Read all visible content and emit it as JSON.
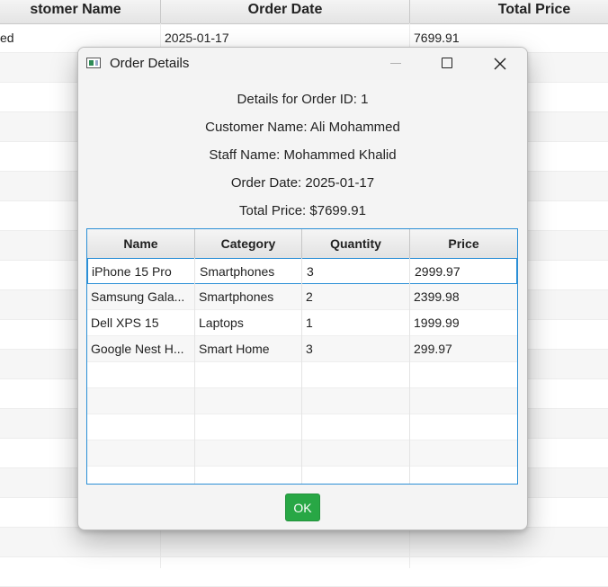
{
  "background_table": {
    "headers": [
      "stomer Name",
      "Order Date",
      "Total Price"
    ],
    "first_row": [
      "ed",
      "2025-01-17",
      "7699.91"
    ]
  },
  "dialog": {
    "title": "Order Details",
    "order_id_line": "Details for Order ID: 1",
    "customer_line": "Customer Name: Ali Mohammed",
    "staff_line": "Staff Name: Mohammed Khalid",
    "date_line": "Order Date: 2025-01-17",
    "total_line": "Total Price: $7699.91",
    "table": {
      "headers": [
        "Name",
        "Category",
        "Quantity",
        "Price"
      ],
      "rows": [
        [
          "iPhone 15 Pro",
          "Smartphones",
          "3",
          "2999.97"
        ],
        [
          "Samsung Gala...",
          "Smartphones",
          "2",
          "2399.98"
        ],
        [
          "Dell XPS 15",
          "Laptops",
          "1",
          "1999.99"
        ],
        [
          "Google Nest H...",
          "Smart Home",
          "3",
          "299.97"
        ]
      ]
    },
    "ok_label": "OK"
  },
  "colors": {
    "accent": "#2b8fd6",
    "ok_button": "#28a745"
  }
}
